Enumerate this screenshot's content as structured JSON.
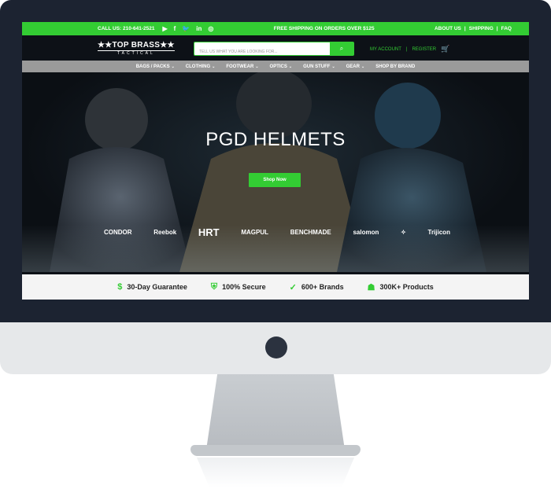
{
  "topbar": {
    "call": "CALL US: 210-641-2521",
    "shipping": "FREE SHIPPING ON ORDERS OVER $125",
    "links": [
      "ABOUT US",
      "|",
      "SHIPPING",
      "|",
      "FAQ"
    ]
  },
  "header": {
    "logo_main": "★★TOP BRASS★★",
    "logo_sub": "TACTICAL",
    "search_placeholder": "TELL US WHAT YOU ARE LOOKING FOR...",
    "my_account": "MY ACCOUNT",
    "register": "REGISTER",
    "separator": "|"
  },
  "nav": [
    "BAGS / PACKS",
    "CLOTHING",
    "FOOTWEAR",
    "OPTICS",
    "GUN STUFF",
    "GEAR",
    "SHOP BY BRAND"
  ],
  "hero": {
    "title": "PGD HELMETS",
    "cta": "Shop Now",
    "brands": [
      "CONDOR",
      "Reebok",
      "HRT",
      "MAGPUL",
      "BENCHMADE",
      "salomon",
      "",
      "Trijicon"
    ]
  },
  "features": [
    {
      "icon": "money-bag-icon",
      "label": "30-Day Guarantee"
    },
    {
      "icon": "shield-icon",
      "label": "100% Secure"
    },
    {
      "icon": "badge-check-icon",
      "label": "600+ Brands"
    },
    {
      "icon": "boxes-icon",
      "label": "300K+ Products"
    }
  ],
  "colors": {
    "accent": "#33cc33",
    "dark": "#0d1117",
    "nav": "#9a9a9a",
    "bezel": "#1c2331"
  }
}
